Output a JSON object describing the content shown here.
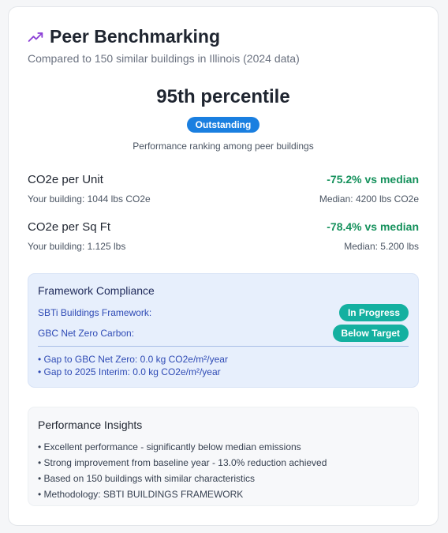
{
  "header": {
    "title": "Peer Benchmarking",
    "subtitle": "Compared to 150 similar buildings in Illinois (2024 data)",
    "icon": "trending-up-icon",
    "icon_color": "#8b3fd6"
  },
  "ranking": {
    "percentile": "95th percentile",
    "badge": "Outstanding",
    "caption": "Performance ranking among peer buildings"
  },
  "metrics": [
    {
      "name": "CO2e per Unit",
      "delta": "-75.2% vs median",
      "yours": "Your building: 1044 lbs CO2e",
      "median": "Median: 4200 lbs CO2e"
    },
    {
      "name": "CO2e per Sq Ft",
      "delta": "-78.4% vs median",
      "yours": "Your building: 1.125 lbs",
      "median": "Median: 5.200 lbs"
    }
  ],
  "compliance": {
    "title": "Framework Compliance",
    "rows": [
      {
        "label": "SBTi Buildings Framework:",
        "status": "In Progress"
      },
      {
        "label": "GBC Net Zero Carbon:",
        "status": "Below Target"
      }
    ],
    "gaps": [
      "• Gap to GBC Net Zero: 0.0 kg CO2e/m²/year",
      "• Gap to 2025 Interim: 0.0 kg CO2e/m²/year"
    ]
  },
  "insights": {
    "title": "Performance Insights",
    "items": [
      "• Excellent performance - significantly below median emissions",
      "• Strong improvement from baseline year - 13.0% reduction achieved",
      "• Based on 150 buildings with similar characteristics",
      "• Methodology: SBTI BUILDINGS FRAMEWORK"
    ]
  },
  "colors": {
    "accent_blue": "#1a7fe0",
    "positive_green": "#15915c",
    "status_teal": "#14b0a0",
    "compliance_bg": "#e7effc"
  }
}
